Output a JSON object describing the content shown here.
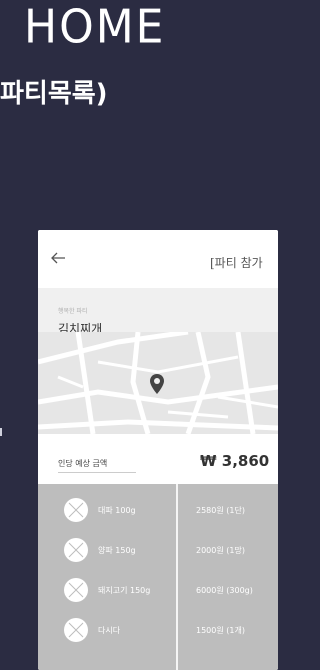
{
  "header": {
    "title": "HOME",
    "subtitle": "파티목록)"
  },
  "screen": {
    "title": "[파티 참가",
    "card": {
      "small_label": "행복한 파티",
      "name": "김치찌개"
    },
    "map_icon": "map-pin-icon",
    "price": {
      "label": "인당 예상 금액",
      "value": "₩ 3,860"
    },
    "items": [
      {
        "name": "대파 100g",
        "price": "2580원 (1단)"
      },
      {
        "name": "양파 150g",
        "price": "2000원 (1망)"
      },
      {
        "name": "돼지고기 150g",
        "price": "6000원 (300g)"
      },
      {
        "name": "다시다",
        "price": "1500원 (1개)"
      }
    ]
  },
  "colors": {
    "background": "#2b2c42",
    "panel": "#bdbdbd",
    "text_light": "#ffffff"
  }
}
